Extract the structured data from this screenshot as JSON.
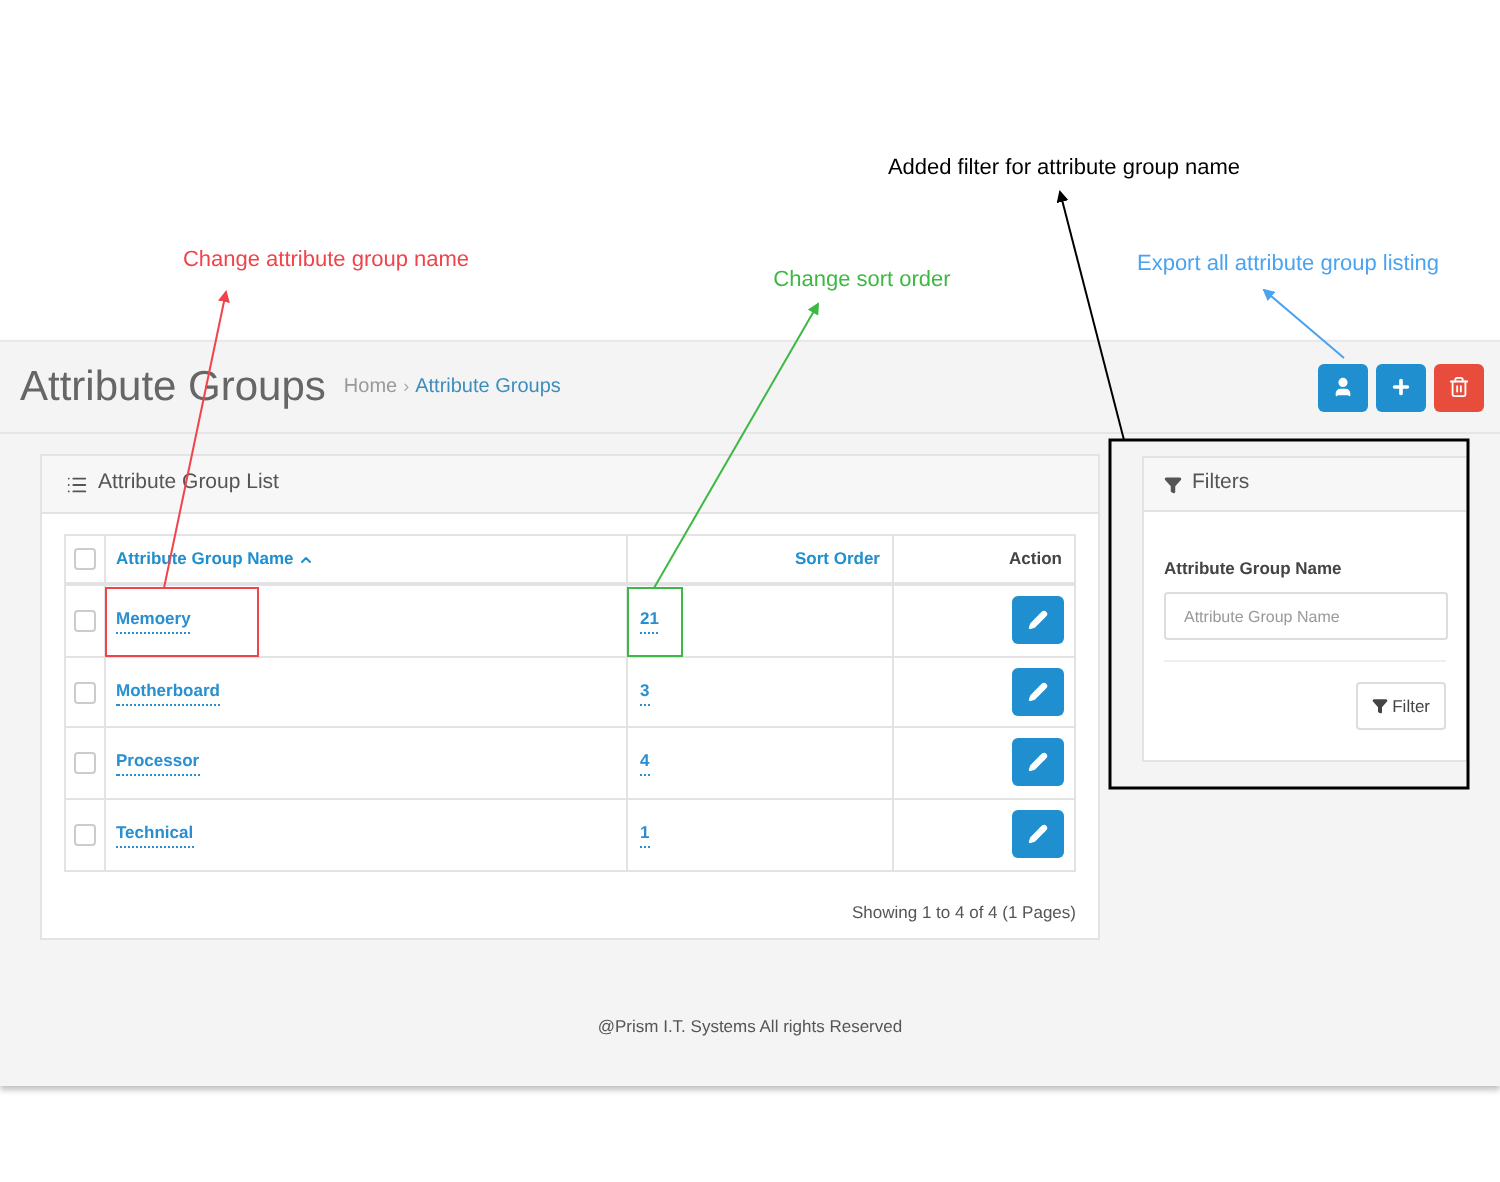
{
  "annotations": [
    {
      "text": "Added filter for attribute group name",
      "color": "#000000"
    },
    {
      "text": "Change attribute group name",
      "color": "#f0434a"
    },
    {
      "text": "Change sort order",
      "color": "#3cb843"
    },
    {
      "text": "Export all attribute group listing",
      "color": "#4aa3f0"
    }
  ],
  "header": {
    "title": "Attribute Groups",
    "separator": "›",
    "breadcrumb": [
      {
        "label": "Home",
        "selected": false
      },
      {
        "label": "Attribute Groups",
        "selected": true
      }
    ]
  },
  "toolbar": [
    {
      "kind": "export",
      "color": "#1f8fd0"
    },
    {
      "kind": "add",
      "color": "#1f8fd0"
    },
    {
      "kind": "delete",
      "color": "#e74c3c"
    }
  ],
  "list_panel": {
    "title": "Attribute Group List",
    "select_all": {
      "checked": false
    },
    "columns": [
      "Attribute Group Name",
      "Sort Order",
      "Action"
    ],
    "rows": [
      {
        "checked": false,
        "name": "Memoery",
        "sort_order": "21"
      },
      {
        "checked": false,
        "name": "Motherboard",
        "sort_order": "3"
      },
      {
        "checked": false,
        "name": "Processor",
        "sort_order": "4"
      },
      {
        "checked": false,
        "name": "Technical",
        "sort_order": "1"
      }
    ],
    "pagination": "Showing 1 to 4 of 4 (1 Pages)"
  },
  "filters": {
    "title": "Filters",
    "field_label": "Attribute Group Name",
    "placeholder": "Attribute Group Name",
    "button": "Filter"
  },
  "footer": "@Prism I.T. Systems All rights Reserved"
}
